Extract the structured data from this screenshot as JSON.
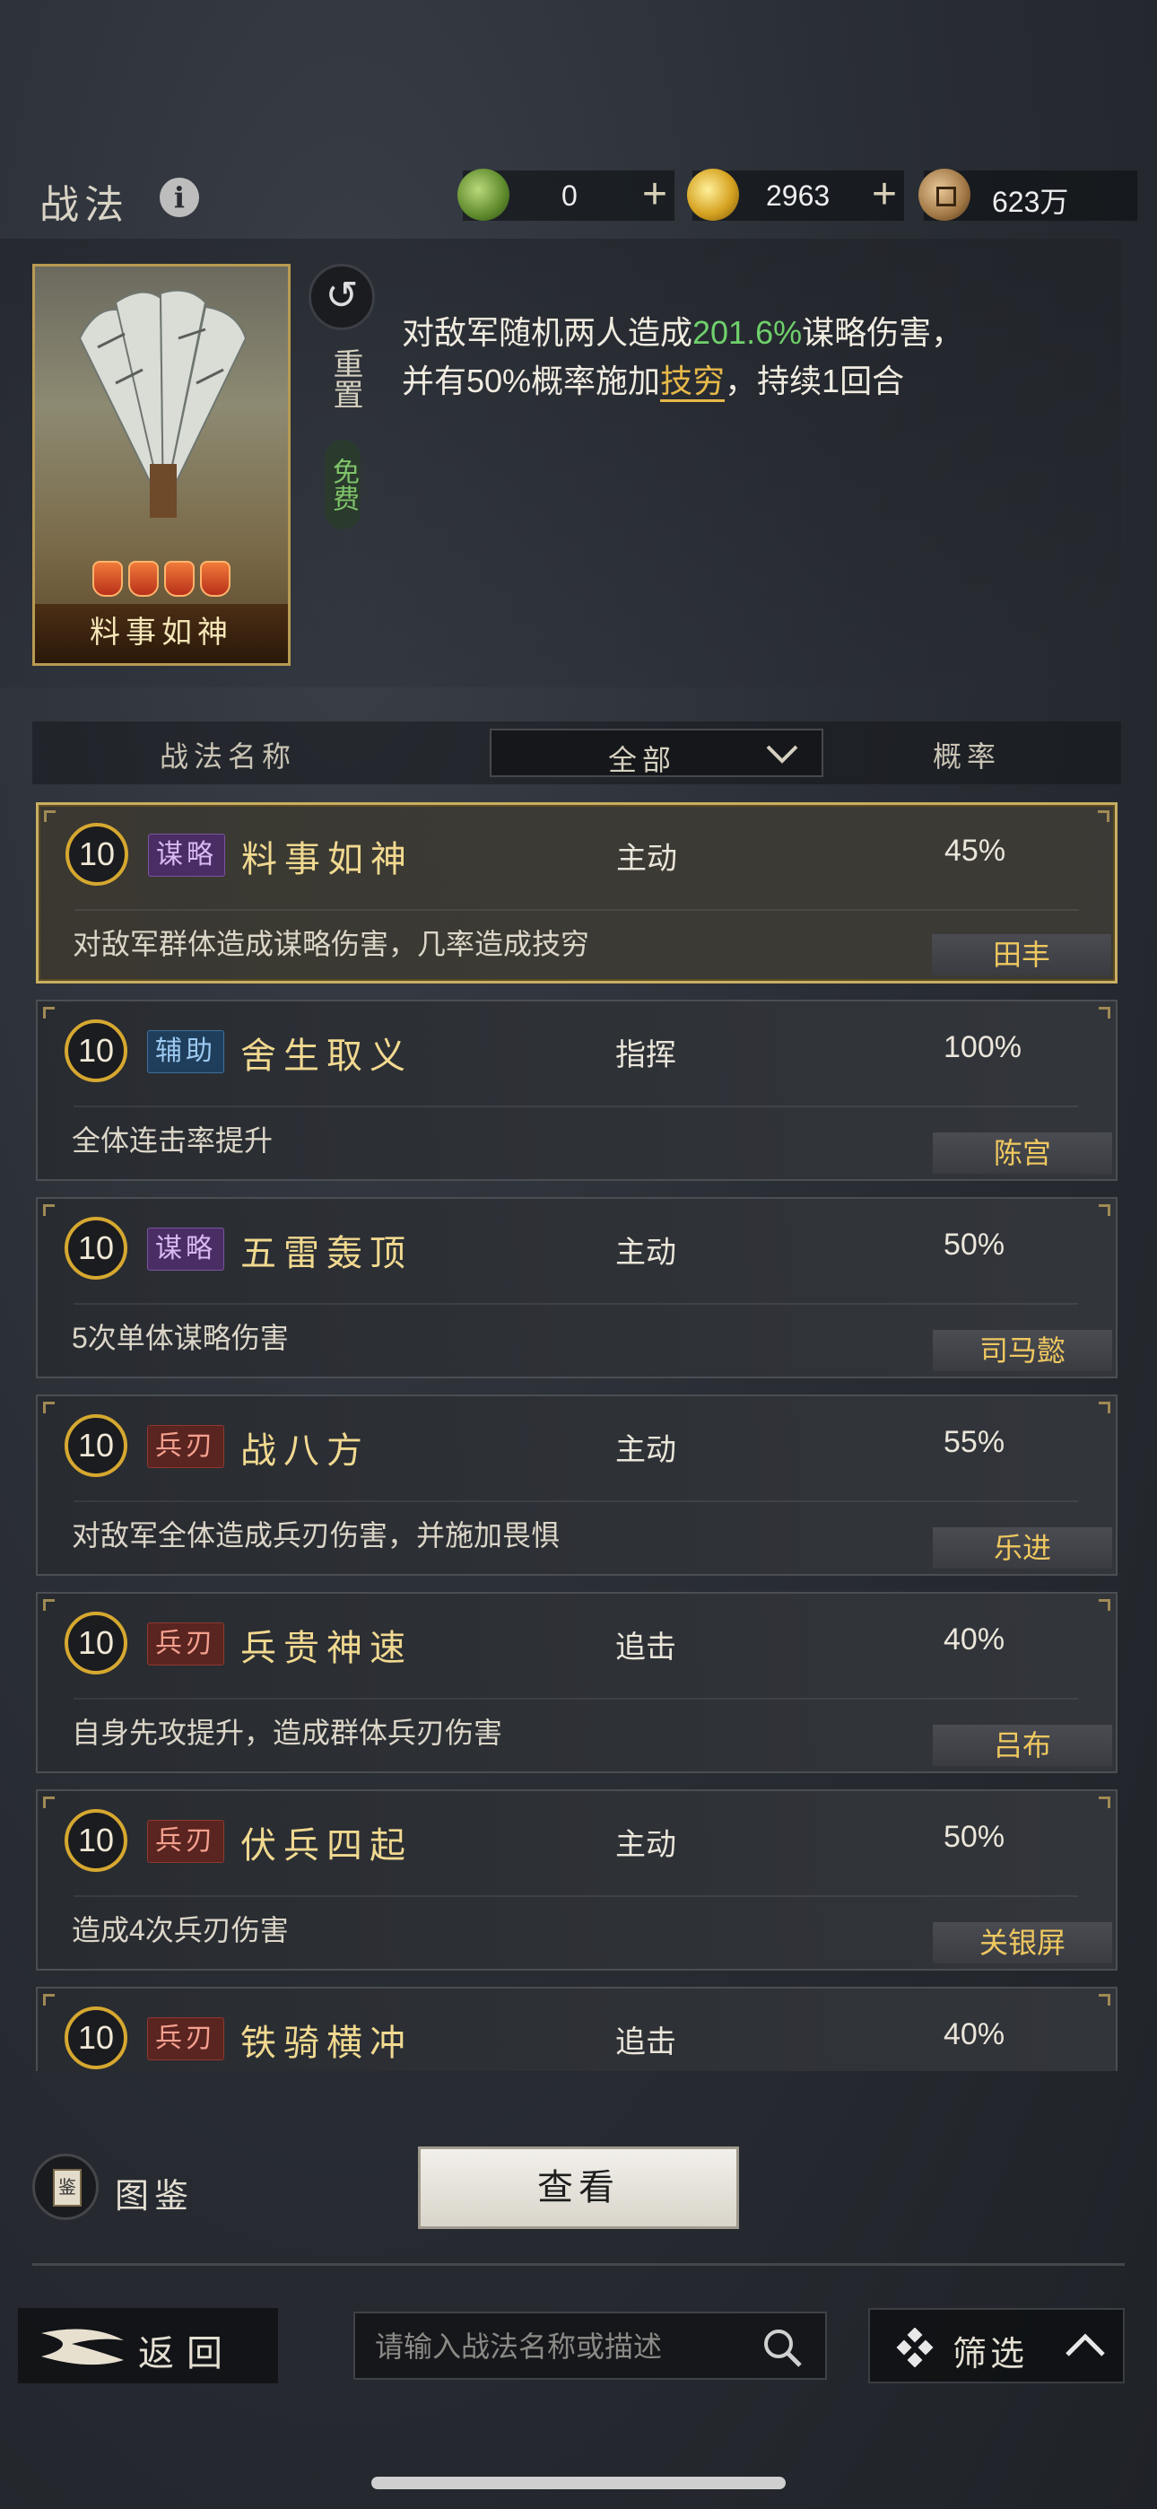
{
  "header": {
    "title": "战法",
    "resources": {
      "jade": {
        "value": "0",
        "icon": "jade-coin-icon"
      },
      "gold": {
        "value": "2963",
        "icon": "gold-coin-icon"
      },
      "copper": {
        "value": "623万",
        "icon": "copper-coin-icon"
      }
    }
  },
  "card": {
    "name": "料事如神",
    "stars": 4
  },
  "reset": {
    "label": "重置",
    "free": "免费"
  },
  "description": {
    "p1": "对敌军随机两人造成",
    "pct": "201.6%",
    "p2": "谋略伤害，",
    "p3": "并有50%概率施加",
    "status": "技穷",
    "p4": "，持续1回合"
  },
  "table": {
    "col_name": "战法名称",
    "filter_value": "全部",
    "col_prob": "概率"
  },
  "skills": [
    {
      "level": "10",
      "tag": "谋略",
      "name": "料事如神",
      "type": "主动",
      "prob": "45%",
      "desc": "对敌军群体造成谋略伤害，几率造成技穷",
      "owner": "田丰"
    },
    {
      "level": "10",
      "tag": "辅助",
      "name": "舍生取义",
      "type": "指挥",
      "prob": "100%",
      "desc": "全体连击率提升",
      "owner": "陈宫"
    },
    {
      "level": "10",
      "tag": "谋略",
      "name": "五雷轰顶",
      "type": "主动",
      "prob": "50%",
      "desc": "5次单体谋略伤害",
      "owner": "司马懿"
    },
    {
      "level": "10",
      "tag": "兵刃",
      "name": "战八方",
      "type": "主动",
      "prob": "55%",
      "desc": "对敌军全体造成兵刃伤害，并施加畏惧",
      "owner": "乐进"
    },
    {
      "level": "10",
      "tag": "兵刃",
      "name": "兵贵神速",
      "type": "追击",
      "prob": "40%",
      "desc": "自身先攻提升，造成群体兵刃伤害",
      "owner": "吕布"
    },
    {
      "level": "10",
      "tag": "兵刃",
      "name": "伏兵四起",
      "type": "主动",
      "prob": "50%",
      "desc": "造成4次兵刃伤害",
      "owner": "关银屏"
    },
    {
      "level": "10",
      "tag": "兵刃",
      "name": "铁骑横冲",
      "type": "追击",
      "prob": "40%",
      "desc": "",
      "owner": ""
    }
  ],
  "codex": {
    "label": "图鉴",
    "icon_char": "鉴"
  },
  "view_button": "查看",
  "footer": {
    "back_label": "返回",
    "search_placeholder": "请输入战法名称或描述",
    "filter_label": "筛选"
  }
}
